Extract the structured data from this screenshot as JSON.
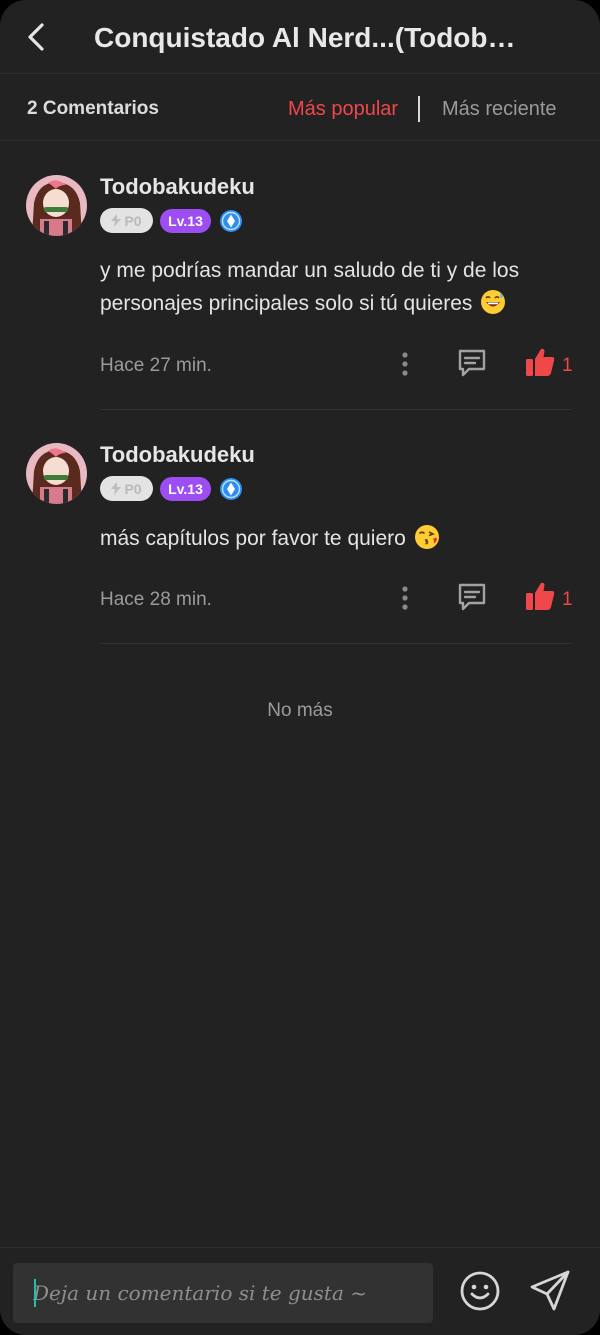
{
  "header": {
    "title": "Conquistado Al Nerd...(Todob…"
  },
  "sort": {
    "count_label": "2 Comentarios",
    "popular_label": "Más popular",
    "recent_label": "Más reciente"
  },
  "comments": [
    {
      "username": "Todobakudeku",
      "points_badge": "P0",
      "level_badge": "Lv.13",
      "text": "y me podrías mandar un saludo de ti y de los personajes principales solo si tú quieres",
      "emoji": "grinning-sweat",
      "time": "Hace 27 min.",
      "likes": "1"
    },
    {
      "username": "Todobakudeku",
      "points_badge": "P0",
      "level_badge": "Lv.13",
      "text": "más capítulos por favor te quiero",
      "emoji": "face-blowing-kiss",
      "time": "Hace 28 min.",
      "likes": "1"
    }
  ],
  "footer": {
    "no_more": "No más"
  },
  "input": {
    "placeholder": "Deja un comentario si te gusta ~"
  },
  "colors": {
    "accent": "#f0474a",
    "background": "#222223",
    "level_badge": "#9c4ef2"
  }
}
